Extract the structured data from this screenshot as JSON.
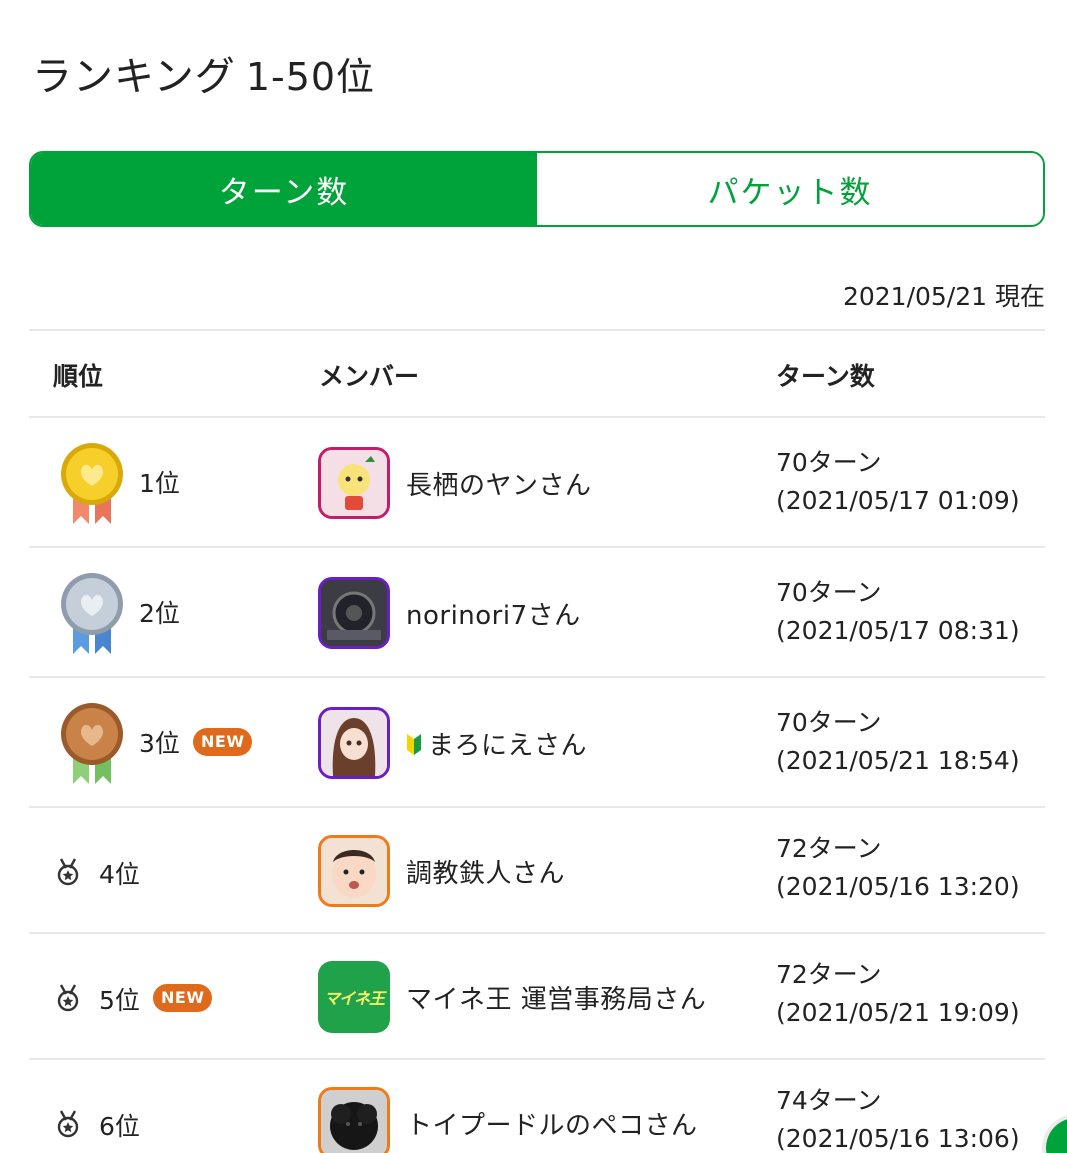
{
  "header": {
    "title": "ランキング",
    "range": "1-50位"
  },
  "tabs": [
    {
      "label": "ターン数",
      "active": true
    },
    {
      "label": "パケット数",
      "active": false
    }
  ],
  "date": "2021/05/21 現在",
  "table": {
    "headers": {
      "rank": "順位",
      "member": "メンバー",
      "turns": "ターン数"
    },
    "rows": [
      {
        "rank": "1位",
        "medal": "gold-medal",
        "new": "",
        "name": "長栖のヤンさん",
        "turns": "70ターン",
        "datetime": "(2021/05/17 01:09)"
      },
      {
        "rank": "2位",
        "medal": "silver-medal",
        "new": "",
        "name": "norinori7さん",
        "turns": "70ターン",
        "datetime": "(2021/05/17 08:31)"
      },
      {
        "rank": "3位",
        "medal": "bronze-medal",
        "new": "NEW",
        "name": "まろにえさん",
        "beginner_mark": true,
        "turns": "70ターン",
        "datetime": "(2021/05/21 18:54)"
      },
      {
        "rank": "4位",
        "medal": "medal-outline-icon",
        "new": "",
        "name": "調教鉄人さん",
        "turns": "72ターン",
        "datetime": "(2021/05/16 13:20)"
      },
      {
        "rank": "5位",
        "medal": "medal-outline-icon",
        "new": "NEW",
        "name": "マイネ王 運営事務局さん",
        "avatar_text": "マイネ王",
        "turns": "72ターン",
        "datetime": "(2021/05/21 19:09)"
      },
      {
        "rank": "6位",
        "medal": "medal-outline-icon",
        "new": "",
        "name": "トイプードルのペコさん",
        "turns": "74ターン",
        "datetime": "(2021/05/16 13:06)"
      }
    ]
  },
  "colors": {
    "accent": "#00a23a",
    "new_badge": "#e06a1b",
    "divider": "#e8e8e8"
  }
}
